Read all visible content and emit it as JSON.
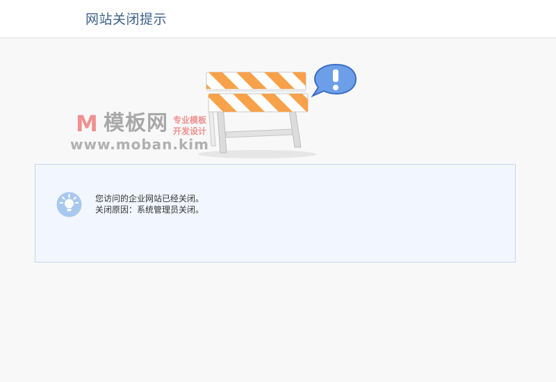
{
  "header": {
    "title": "网站关闭提示"
  },
  "illustration": {
    "image": "road-barrier-with-exclamation-bubble",
    "watermark": {
      "logo_letter": "M",
      "site_name": "模板网",
      "tagline_1": "专业模板",
      "tagline_2": "开发设计",
      "url": "www.moban.kim"
    }
  },
  "notice": {
    "icon": "lightbulb-icon",
    "line_1": "您访问的企业网站已经关闭。",
    "line_2": "关闭原因：系统管理员关闭。"
  },
  "colors": {
    "header_title": "#3c5f8c",
    "notice_bg": "#f2f6fe",
    "notice_border": "#c5d5ef",
    "barrier_orange": "#f7a24a",
    "bubble_blue": "#6d9fe8"
  }
}
